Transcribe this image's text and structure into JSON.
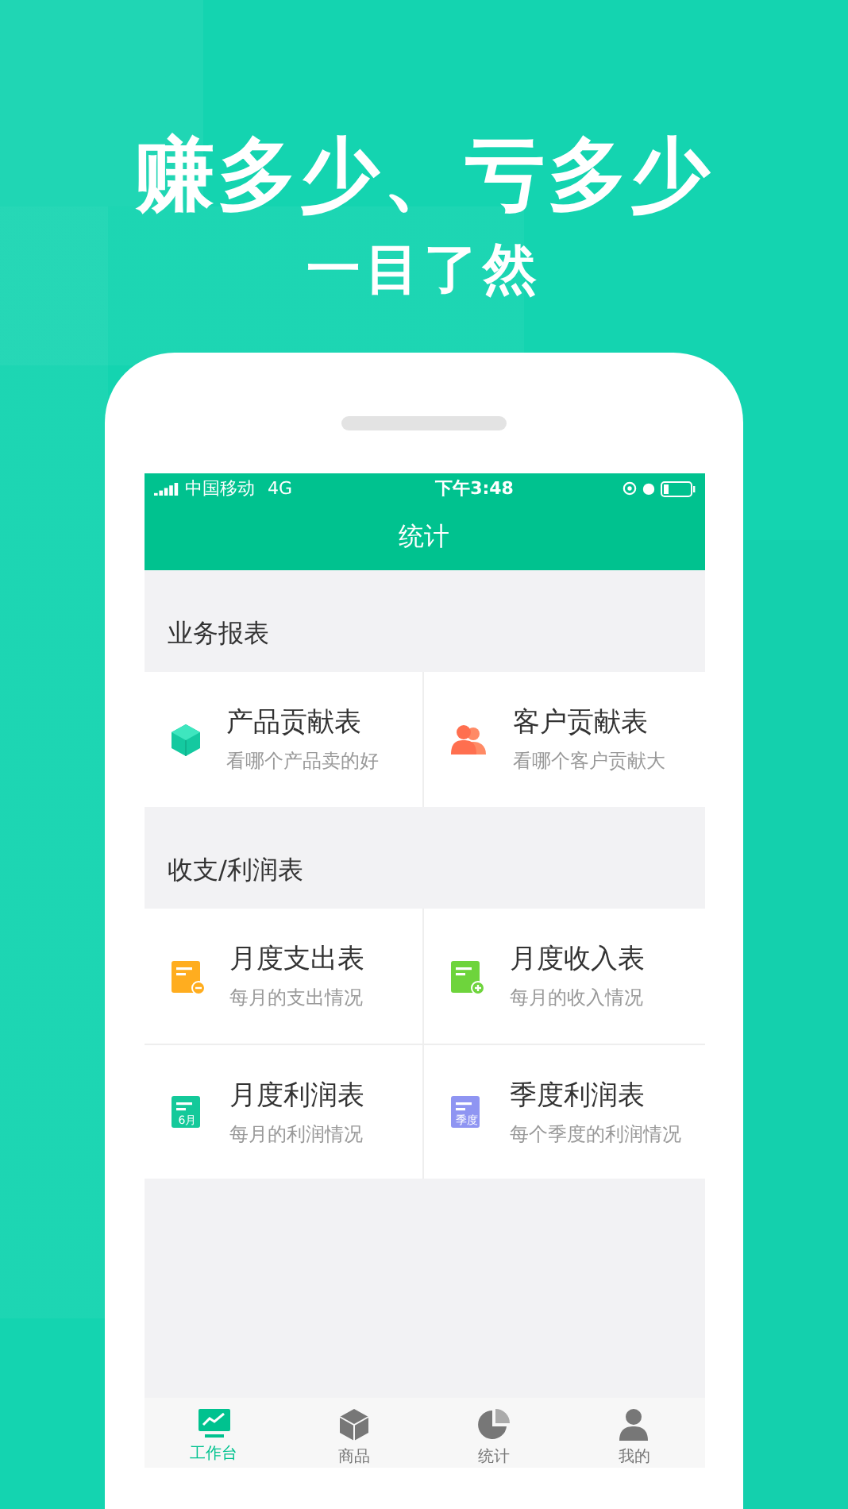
{
  "headline": "赚多少、亏多少",
  "subheadline": "一目了然",
  "status_bar": {
    "carrier": "中国移动",
    "network": "4G",
    "time": "下午3:48"
  },
  "nav_title": "统计",
  "sections": [
    {
      "title": "业务报表",
      "items": [
        {
          "kind": "cube",
          "title": "产品贡献表",
          "subtitle": "看哪个产品卖的好"
        },
        {
          "kind": "people",
          "title": "客户贡献表",
          "subtitle": "看哪个客户贡献大"
        }
      ]
    },
    {
      "title": "收支/利润表",
      "items": [
        {
          "kind": "expense",
          "title": "月度支出表",
          "subtitle": "每月的支出情况"
        },
        {
          "kind": "income",
          "title": "月度收入表",
          "subtitle": "每月的收入情况"
        },
        {
          "kind": "monthly",
          "title": "月度利润表",
          "subtitle": "每月的利润情况",
          "icon_label": "6月"
        },
        {
          "kind": "quarterly",
          "title": "季度利润表",
          "subtitle": "每个季度的利润情况",
          "icon_label": "季度"
        }
      ]
    }
  ],
  "tabs": [
    {
      "kind": "chart",
      "label": "工作台",
      "selected": true
    },
    {
      "kind": "box",
      "label": "商品",
      "selected": false
    },
    {
      "kind": "pie",
      "label": "统计",
      "selected": false
    },
    {
      "kind": "person",
      "label": "我的",
      "selected": false
    }
  ]
}
